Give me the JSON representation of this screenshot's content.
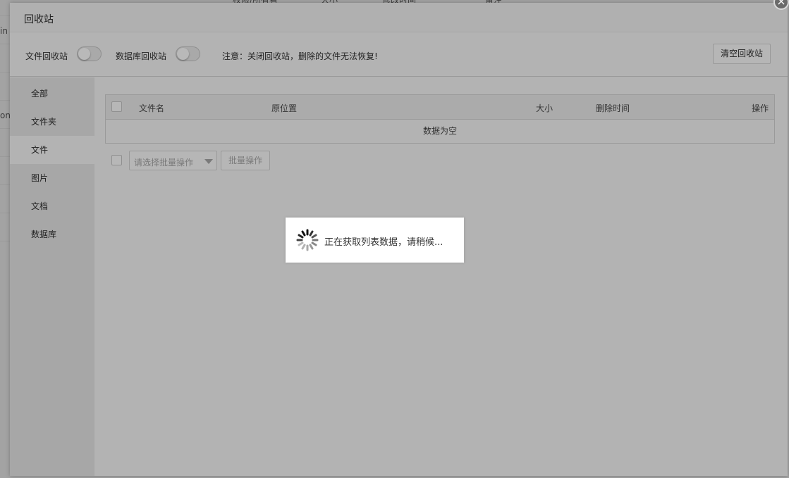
{
  "background": {
    "headers": [
      "权限/所有者",
      "大小",
      "修改时间",
      "备注"
    ],
    "row_edges": [
      "in",
      "on"
    ]
  },
  "modal": {
    "title": "回收站",
    "close_icon": "close-icon"
  },
  "settings": {
    "file_recycle_label": "文件回收站",
    "file_recycle_on": false,
    "db_recycle_label": "数据库回收站",
    "db_recycle_on": false,
    "notice": "注意：关闭回收站，删除的文件无法恢复!",
    "clear_button": "清空回收站"
  },
  "sidebar": {
    "items": [
      {
        "label": "全部",
        "active": false
      },
      {
        "label": "文件夹",
        "active": false
      },
      {
        "label": "文件",
        "active": true
      },
      {
        "label": "图片",
        "active": false
      },
      {
        "label": "文档",
        "active": false
      },
      {
        "label": "数据库",
        "active": false
      }
    ]
  },
  "table": {
    "columns": [
      "文件名",
      "原位置",
      "大小",
      "删除时间",
      "操作"
    ],
    "empty_text": "数据为空"
  },
  "batch": {
    "select_placeholder": "请选择批量操作",
    "button": "批量操作"
  },
  "loading": {
    "text": "正在获取列表数据，请稍候..."
  },
  "colors": {
    "overlay": "#a3a3a3",
    "modal_bg": "#b3b3b3",
    "loading_bg": "#ffffff"
  }
}
